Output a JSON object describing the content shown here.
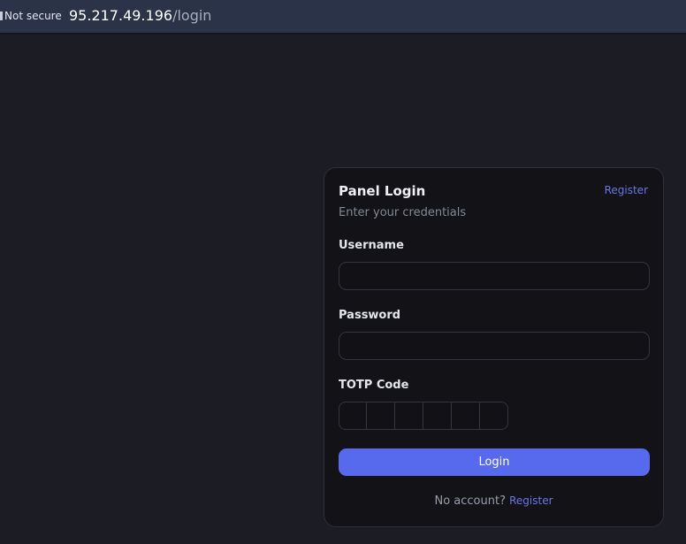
{
  "browser": {
    "security_label": "Not secure",
    "url_host": "95.217.49.196",
    "url_path": "/login"
  },
  "login": {
    "title": "Panel Login",
    "register_link": "Register",
    "subtitle": "Enter your credentials",
    "username_label": "Username",
    "username_value": "",
    "password_label": "Password",
    "password_value": "",
    "totp_label": "TOTP Code",
    "totp_digits": [
      "",
      "",
      "",
      "",
      "",
      ""
    ],
    "submit_label": "Login",
    "footer_text": "No account?",
    "footer_link": "Register"
  },
  "colors": {
    "background": "#1c1c24",
    "card": "#121217",
    "accent": "#5769ec",
    "link": "#6a76e8"
  }
}
